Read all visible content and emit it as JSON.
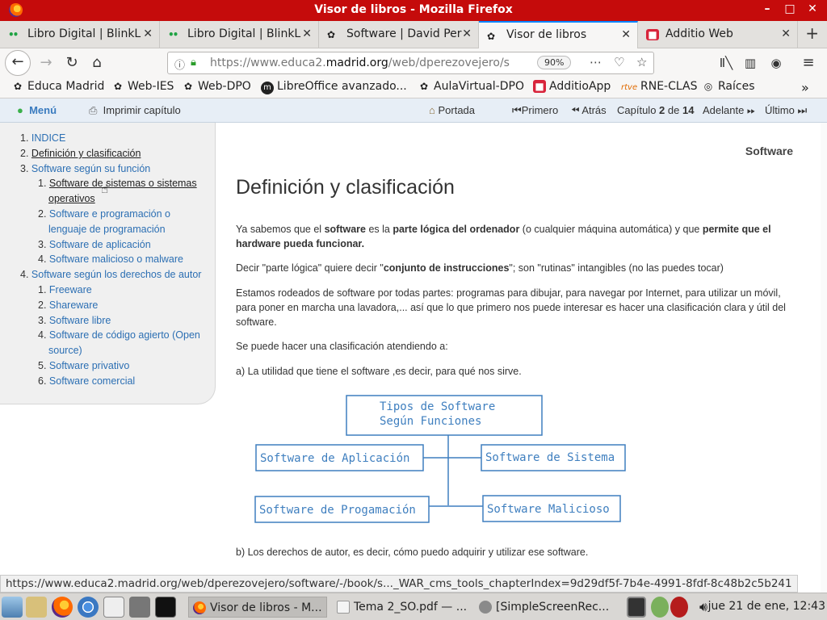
{
  "window": {
    "title": "Visor de libros - Mozilla Firefox"
  },
  "tabs": [
    {
      "label": "Libro Digital | BlinkL",
      "icon": "dots-icon"
    },
    {
      "label": "Libro Digital | BlinkL",
      "icon": "dots-icon"
    },
    {
      "label": "Software | David Per",
      "icon": "educamadrid-icon"
    },
    {
      "label": "Visor de libros",
      "icon": "educamadrid-icon",
      "active": true
    },
    {
      "label": "Additio Web",
      "icon": "additio-icon"
    }
  ],
  "nav": {
    "url_prefix": "https://www.educa2.",
    "url_domain": "madrid.org",
    "url_suffix": "/web/dperezovejero/s",
    "zoom": "90%"
  },
  "bookmarks": [
    {
      "label": "Educa Madrid",
      "icon": "educamadrid-icon"
    },
    {
      "label": "Web-IES",
      "icon": "educamadrid-icon"
    },
    {
      "label": "Web-DPO",
      "icon": "educamadrid-icon"
    },
    {
      "label": "LibreOffice avanzado...",
      "icon": "m-icon"
    },
    {
      "label": "AulaVirtual-DPO",
      "icon": "educamadrid-icon"
    },
    {
      "label": "AdditioApp",
      "icon": "additio-icon"
    },
    {
      "label": "RNE-CLAS",
      "icon": "rtve-icon"
    },
    {
      "label": "Raíces",
      "icon": "globe-icon"
    }
  ],
  "book_toolbar": {
    "menu": "Menú",
    "print": "Imprimir capítulo",
    "home": "Portada",
    "first": "Primero",
    "back": "Atrás",
    "chapter_prefix": "Capítulo",
    "chapter_current": "2",
    "chapter_of": "de",
    "chapter_total": "14",
    "next": "Adelante",
    "last": "Último"
  },
  "toc": [
    {
      "num": "1.",
      "label": "INDICE",
      "level": 0
    },
    {
      "num": "2.",
      "label": "Definición y clasificación",
      "level": 0,
      "current": true
    },
    {
      "num": "3.",
      "label": "Software según su función",
      "level": 0
    },
    {
      "num": "1.",
      "label": "Software de sistemas o sistemas",
      "label2": "operativos",
      "level": 1,
      "hover": true
    },
    {
      "num": "2.",
      "label": "Software e programación o",
      "label2": "lenguaje de programación",
      "level": 1
    },
    {
      "num": "3.",
      "label": "Software de aplicación",
      "level": 1
    },
    {
      "num": "4.",
      "label": "Software malicioso o malware",
      "level": 1
    },
    {
      "num": "4.",
      "label": "Software según los derechos de autor",
      "level": 0
    },
    {
      "num": "1.",
      "label": "Freeware",
      "level": 1
    },
    {
      "num": "2.",
      "label": "Shareware",
      "level": 1
    },
    {
      "num": "3.",
      "label": "Software libre",
      "level": 1
    },
    {
      "num": "4.",
      "label": "Software de código agierto (Open",
      "label2": "source)",
      "level": 1
    },
    {
      "num": "5.",
      "label": "Software privativo",
      "level": 1
    },
    {
      "num": "6.",
      "label": "Software comercial",
      "level": 1
    }
  ],
  "content": {
    "book_title": "Software",
    "heading": "Definición y clasificación",
    "p1_a": "Ya sabemos que el ",
    "p1_b": "software",
    "p1_c": " es la ",
    "p1_d": "parte lógica del ordenador",
    "p1_e": " (o cualquier máquina automática) y que ",
    "p1_f": "permite que el hardware pueda funcionar.",
    "p2_a": "Decir \"parte lógica\" quiere decir \"",
    "p2_b": "conjunto de instrucciones",
    "p2_c": "\"; son \"rutinas\" intangibles (no las puedes tocar)",
    "p3": "Estamos rodeados de software por todas partes: programas para dibujar, para navegar por Internet, para utilizar un móvil, para poner en marcha una lavadora,... así que lo que primero nos puede interesar es hacer una clasificación clara y útil del software.",
    "p4": "Se puede hacer una clasificación atendiendo a:",
    "p5": "a) La utilidad que tiene el software ,es decir, para qué nos sirve.",
    "p6": "b) Los derechos de autor, es decir, cómo puedo adquirir y utilizar ese software."
  },
  "diagram": {
    "root_line1": "Tipos de Software",
    "root_line2": "Según Funciones",
    "left_top": "Software de Aplicación",
    "right_top": "Software de Sistema",
    "left_bottom": "Software de Progamación",
    "right_bottom": "Software Malicioso",
    "color": "#3f7fbf"
  },
  "status_url": "https://www.educa2.madrid.org/web/dperezovejero/software/-/book/s..._WAR_cms_tools_chapterIndex=9d29df5f-7b4e-4991-8fdf-8c48b2c5b241",
  "taskbar": {
    "windows": [
      {
        "label": "Visor de libros - M...",
        "active": true
      },
      {
        "label": "Tema 2_SO.pdf — ..."
      },
      {
        "label": "[SimpleScreenRec..."
      }
    ],
    "clock": "jue 21 de ene, 12:43"
  },
  "colors": {
    "titlebar": "#c50b0b",
    "link": "#2c6fb3",
    "accent": "#0a84ff"
  }
}
